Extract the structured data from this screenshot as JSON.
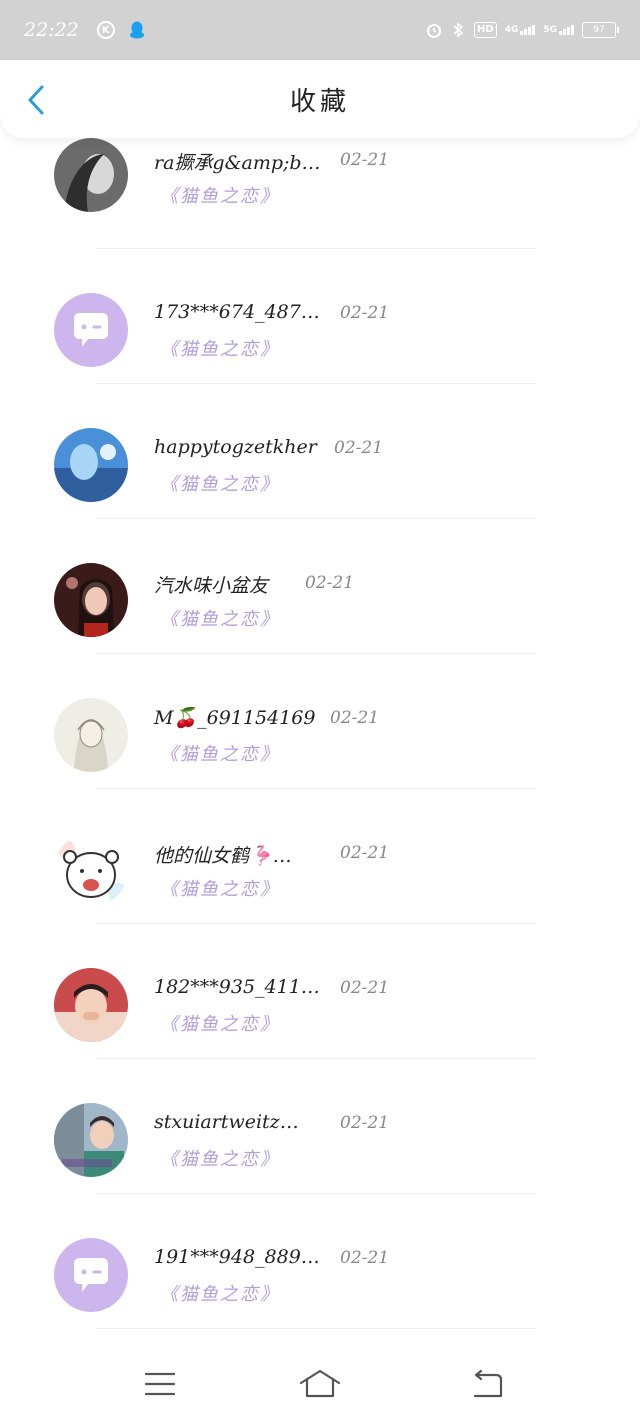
{
  "status_bar": {
    "time": "22:22",
    "k_label": "K",
    "hd_label": "HD",
    "net1_label": "4G",
    "net2_label": "5G",
    "battery_level": "97",
    "icons": [
      "k-icon",
      "qq-icon",
      "alarm-icon",
      "bluetooth-icon",
      "hd-icon",
      "signal-icon",
      "battery-icon"
    ]
  },
  "header": {
    "title": "收藏",
    "back_icon": "chevron-left-icon"
  },
  "favorites": [
    {
      "name": "ra撅承g&amp;b…",
      "date": "02-21",
      "book": "《猫鱼之恋》",
      "avatar": "photo-grayscale"
    },
    {
      "name": "173***674_487…",
      "date": "02-21",
      "book": "《猫鱼之恋》",
      "avatar": "default-chat"
    },
    {
      "name": "happytogzetkher",
      "date": "02-21",
      "book": "《猫鱼之恋》",
      "avatar": "photo-blue"
    },
    {
      "name": "汽水味小盆友",
      "date": "02-21",
      "book": "《猫鱼之恋》",
      "avatar": "photo-red"
    },
    {
      "name": "M🍒_691154169",
      "date": "02-21",
      "book": "《猫鱼之恋》",
      "avatar": "photo-sketch"
    },
    {
      "name": "他的仙女鹤🦩…",
      "date": "02-21",
      "book": "《猫鱼之恋》",
      "avatar": "polar-bear"
    },
    {
      "name": "182***935_411…",
      "date": "02-21",
      "book": "《猫鱼之恋》",
      "avatar": "photo-child"
    },
    {
      "name": "stxuiartweitz…",
      "date": "02-21",
      "book": "《猫鱼之恋》",
      "avatar": "photo-boy"
    },
    {
      "name": "191***948_889…",
      "date": "02-21",
      "book": "《猫鱼之恋》",
      "avatar": "default-chat"
    }
  ],
  "nav_bar": {
    "icons": [
      "menu-icon",
      "home-icon",
      "back-icon"
    ]
  },
  "colors": {
    "accent": "#2d9cdb",
    "book_title": "#b39ddb",
    "default_avatar": "#cdb6ee",
    "status_bar": "#d2d2d2"
  }
}
